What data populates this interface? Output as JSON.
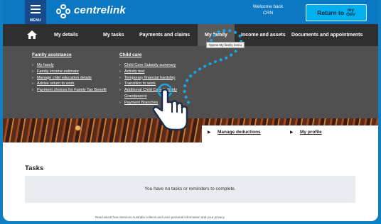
{
  "header": {
    "menu_label": "MENU",
    "brand": "centrelink",
    "welcome_line1": "Welcome back",
    "welcome_line2": "CRN",
    "mygov_button": "Return to",
    "mygov_mark_top": "my",
    "mygov_mark_bottom": "Gov"
  },
  "nav": {
    "items": [
      {
        "label": "My details"
      },
      {
        "label": "My tasks"
      },
      {
        "label": "Payments and claims"
      },
      {
        "label": "My family"
      },
      {
        "label": "Income and assets"
      },
      {
        "label": "Documents and appointments"
      }
    ],
    "active": "My family",
    "tooltip": "Opens My family menu"
  },
  "mega_menu": {
    "family_assistance": {
      "title": "Family assistance",
      "links": [
        "My family",
        "Family income estimate",
        "Manage child education details",
        "Advise return to work",
        "Payment choices for Family Tax Benefit"
      ]
    },
    "child_care": {
      "title": "Child care",
      "links": [
        "Child Care Subsidy summary",
        "Activity test",
        "Temporary financial hardship",
        "Transition to work",
        "Additional Child Care Subsidy Grandparent",
        "Payment Branches"
      ]
    }
  },
  "banner_links": [
    "Manage deductions",
    "My profile"
  ],
  "tasks": {
    "title": "Tasks",
    "empty_message": "You have no tasks or reminders to complete."
  },
  "footer_note": "Read about how Services Australia collects and uses personal information and your privacy",
  "colors": {
    "brand_blue": "#0c78c3",
    "nav_bg": "#2f2f2f",
    "mega_bg": "#505050",
    "active_tab": "#5a5a5a",
    "mygov_button": "#00b0ef",
    "dotted_path": "#19a4e8"
  },
  "icons": {
    "menu": "hamburger-icon",
    "brand": "centrelink-logo-icon",
    "home": "home-icon",
    "pointer": "pointing-hand-icon"
  }
}
